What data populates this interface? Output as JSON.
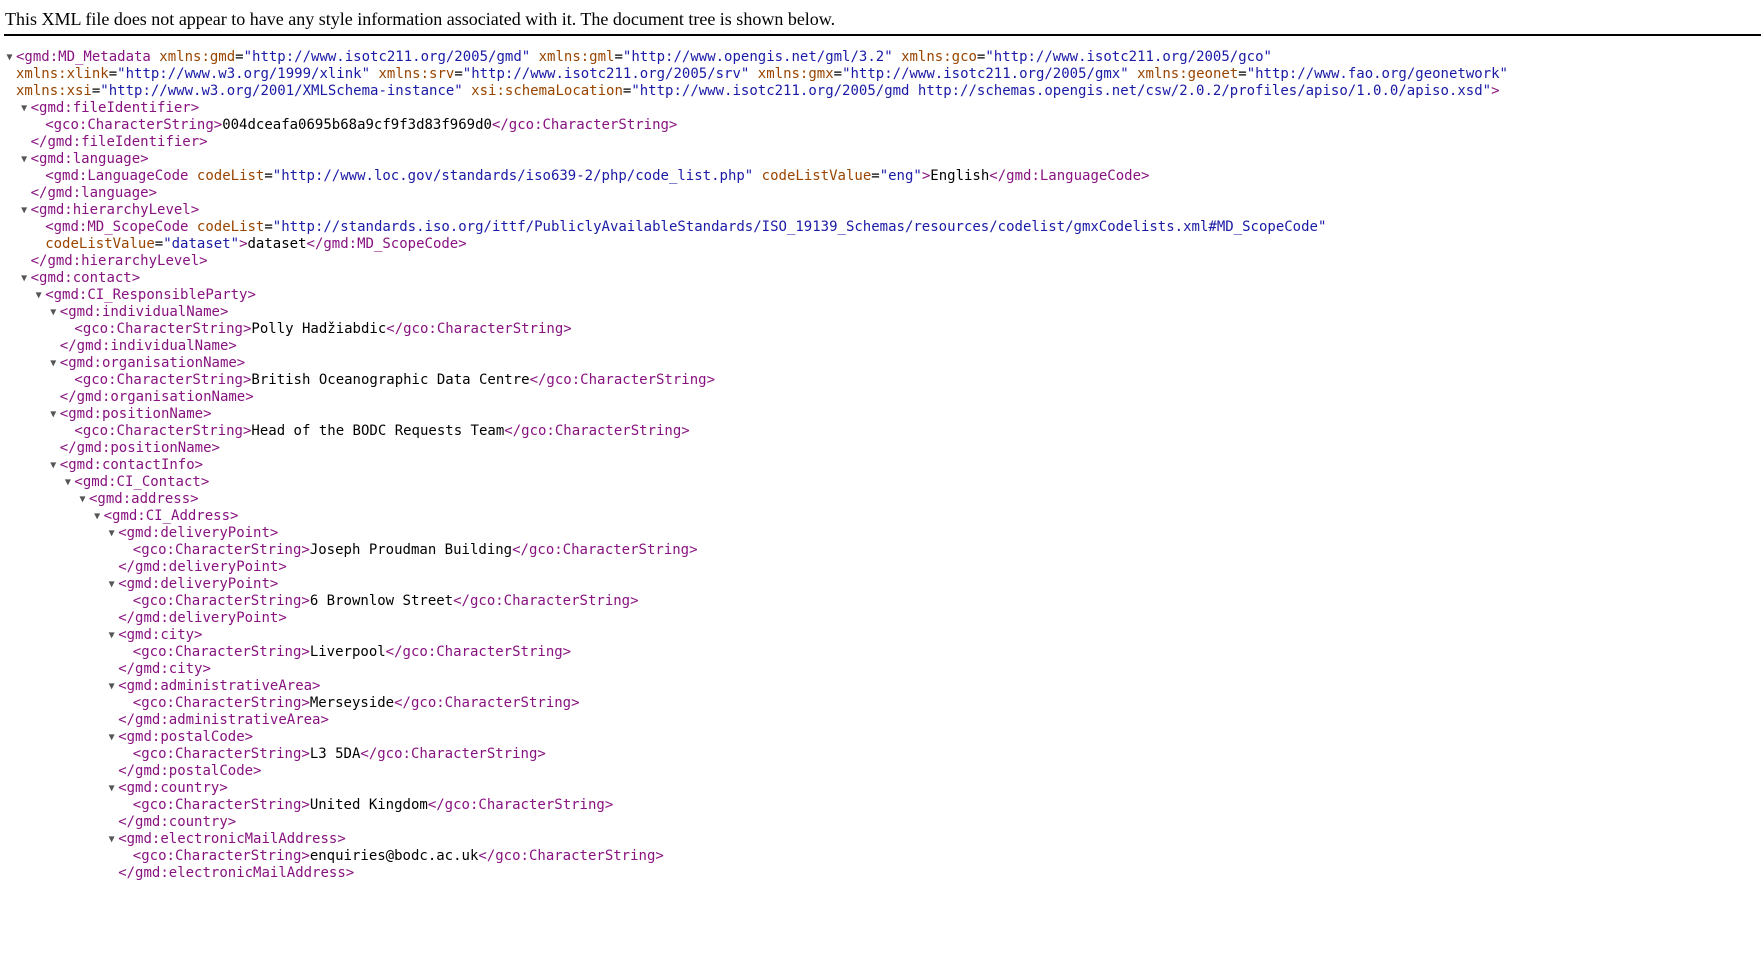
{
  "banner": "This XML file does not appear to have any style information associated with it. The document tree is shown below.",
  "tree": [
    {
      "indent": 0,
      "toggle": true,
      "parts": [
        [
          "t",
          "<gmd:MD_Metadata"
        ],
        [
          "x",
          " "
        ],
        [
          "n",
          "xmlns:gmd"
        ],
        [
          "x",
          "="
        ],
        [
          "v",
          "\"http://www.isotc211.org/2005/gmd\""
        ],
        [
          "x",
          " "
        ],
        [
          "n",
          "xmlns:gml"
        ],
        [
          "x",
          "="
        ],
        [
          "v",
          "\"http://www.opengis.net/gml/3.2\""
        ],
        [
          "x",
          " "
        ],
        [
          "n",
          "xmlns:gco"
        ],
        [
          "x",
          "="
        ],
        [
          "v",
          "\"http://www.isotc211.org/2005/gco\""
        ]
      ]
    },
    {
      "indent": 0,
      "toggle": false,
      "parts": [
        [
          "n",
          "xmlns:xlink"
        ],
        [
          "x",
          "="
        ],
        [
          "v",
          "\"http://www.w3.org/1999/xlink\""
        ],
        [
          "x",
          " "
        ],
        [
          "n",
          "xmlns:srv"
        ],
        [
          "x",
          "="
        ],
        [
          "v",
          "\"http://www.isotc211.org/2005/srv\""
        ],
        [
          "x",
          " "
        ],
        [
          "n",
          "xmlns:gmx"
        ],
        [
          "x",
          "="
        ],
        [
          "v",
          "\"http://www.isotc211.org/2005/gmx\""
        ],
        [
          "x",
          " "
        ],
        [
          "n",
          "xmlns:geonet"
        ],
        [
          "x",
          "="
        ],
        [
          "v",
          "\"http://www.fao.org/geonetwork\""
        ]
      ]
    },
    {
      "indent": 0,
      "toggle": false,
      "parts": [
        [
          "n",
          "xmlns:xsi"
        ],
        [
          "x",
          "="
        ],
        [
          "v",
          "\"http://www.w3.org/2001/XMLSchema-instance\""
        ],
        [
          "x",
          " "
        ],
        [
          "n",
          "xsi:schemaLocation"
        ],
        [
          "x",
          "="
        ],
        [
          "v",
          "\"http://www.isotc211.org/2005/gmd http://schemas.opengis.net/csw/2.0.2/profiles/apiso/1.0.0/apiso.xsd\""
        ],
        [
          "t",
          ">"
        ]
      ]
    },
    {
      "indent": 1,
      "toggle": true,
      "parts": [
        [
          "t",
          "<gmd:fileIdentifier>"
        ]
      ]
    },
    {
      "indent": 2,
      "toggle": false,
      "parts": [
        [
          "t",
          "<gco:CharacterString>"
        ],
        [
          "x",
          "004dceafa0695b68a9cf9f3d83f969d0"
        ],
        [
          "t",
          "</gco:CharacterString>"
        ]
      ]
    },
    {
      "indent": 1,
      "toggle": false,
      "parts": [
        [
          "t",
          "</gmd:fileIdentifier>"
        ]
      ]
    },
    {
      "indent": 1,
      "toggle": true,
      "parts": [
        [
          "t",
          "<gmd:language>"
        ]
      ]
    },
    {
      "indent": 2,
      "toggle": false,
      "parts": [
        [
          "t",
          "<gmd:LanguageCode"
        ],
        [
          "x",
          " "
        ],
        [
          "n",
          "codeList"
        ],
        [
          "x",
          "="
        ],
        [
          "v",
          "\"http://www.loc.gov/standards/iso639-2/php/code_list.php\""
        ],
        [
          "x",
          " "
        ],
        [
          "n",
          "codeListValue"
        ],
        [
          "x",
          "="
        ],
        [
          "v",
          "\"eng\""
        ],
        [
          "t",
          ">"
        ],
        [
          "x",
          "English"
        ],
        [
          "t",
          "</gmd:LanguageCode>"
        ]
      ]
    },
    {
      "indent": 1,
      "toggle": false,
      "parts": [
        [
          "t",
          "</gmd:language>"
        ]
      ]
    },
    {
      "indent": 1,
      "toggle": true,
      "parts": [
        [
          "t",
          "<gmd:hierarchyLevel>"
        ]
      ]
    },
    {
      "indent": 2,
      "toggle": false,
      "parts": [
        [
          "t",
          "<gmd:MD_ScopeCode"
        ],
        [
          "x",
          " "
        ],
        [
          "n",
          "codeList"
        ],
        [
          "x",
          "="
        ],
        [
          "v",
          "\"http://standards.iso.org/ittf/PubliclyAvailableStandards/ISO_19139_Schemas/resources/codelist/gmxCodelists.xml#MD_ScopeCode\""
        ]
      ]
    },
    {
      "indent": 2,
      "toggle": false,
      "parts": [
        [
          "n",
          "codeListValue"
        ],
        [
          "x",
          "="
        ],
        [
          "v",
          "\"dataset\""
        ],
        [
          "t",
          ">"
        ],
        [
          "x",
          "dataset"
        ],
        [
          "t",
          "</gmd:MD_ScopeCode>"
        ]
      ]
    },
    {
      "indent": 1,
      "toggle": false,
      "parts": [
        [
          "t",
          "</gmd:hierarchyLevel>"
        ]
      ]
    },
    {
      "indent": 1,
      "toggle": true,
      "parts": [
        [
          "t",
          "<gmd:contact>"
        ]
      ]
    },
    {
      "indent": 2,
      "toggle": true,
      "parts": [
        [
          "t",
          "<gmd:CI_ResponsibleParty>"
        ]
      ]
    },
    {
      "indent": 3,
      "toggle": true,
      "parts": [
        [
          "t",
          "<gmd:individualName>"
        ]
      ]
    },
    {
      "indent": 4,
      "toggle": false,
      "parts": [
        [
          "t",
          "<gco:CharacterString>"
        ],
        [
          "x",
          "Polly Hadžiabdic"
        ],
        [
          "t",
          "</gco:CharacterString>"
        ]
      ]
    },
    {
      "indent": 3,
      "toggle": false,
      "parts": [
        [
          "t",
          "</gmd:individualName>"
        ]
      ]
    },
    {
      "indent": 3,
      "toggle": true,
      "parts": [
        [
          "t",
          "<gmd:organisationName>"
        ]
      ]
    },
    {
      "indent": 4,
      "toggle": false,
      "parts": [
        [
          "t",
          "<gco:CharacterString>"
        ],
        [
          "x",
          "British Oceanographic Data Centre"
        ],
        [
          "t",
          "</gco:CharacterString>"
        ]
      ]
    },
    {
      "indent": 3,
      "toggle": false,
      "parts": [
        [
          "t",
          "</gmd:organisationName>"
        ]
      ]
    },
    {
      "indent": 3,
      "toggle": true,
      "parts": [
        [
          "t",
          "<gmd:positionName>"
        ]
      ]
    },
    {
      "indent": 4,
      "toggle": false,
      "parts": [
        [
          "t",
          "<gco:CharacterString>"
        ],
        [
          "x",
          "Head of the BODC Requests Team"
        ],
        [
          "t",
          "</gco:CharacterString>"
        ]
      ]
    },
    {
      "indent": 3,
      "toggle": false,
      "parts": [
        [
          "t",
          "</gmd:positionName>"
        ]
      ]
    },
    {
      "indent": 3,
      "toggle": true,
      "parts": [
        [
          "t",
          "<gmd:contactInfo>"
        ]
      ]
    },
    {
      "indent": 4,
      "toggle": true,
      "parts": [
        [
          "t",
          "<gmd:CI_Contact>"
        ]
      ]
    },
    {
      "indent": 5,
      "toggle": true,
      "parts": [
        [
          "t",
          "<gmd:address>"
        ]
      ]
    },
    {
      "indent": 6,
      "toggle": true,
      "parts": [
        [
          "t",
          "<gmd:CI_Address>"
        ]
      ]
    },
    {
      "indent": 7,
      "toggle": true,
      "parts": [
        [
          "t",
          "<gmd:deliveryPoint>"
        ]
      ]
    },
    {
      "indent": 8,
      "toggle": false,
      "parts": [
        [
          "t",
          "<gco:CharacterString>"
        ],
        [
          "x",
          "Joseph Proudman Building"
        ],
        [
          "t",
          "</gco:CharacterString>"
        ]
      ]
    },
    {
      "indent": 7,
      "toggle": false,
      "parts": [
        [
          "t",
          "</gmd:deliveryPoint>"
        ]
      ]
    },
    {
      "indent": 7,
      "toggle": true,
      "parts": [
        [
          "t",
          "<gmd:deliveryPoint>"
        ]
      ]
    },
    {
      "indent": 8,
      "toggle": false,
      "parts": [
        [
          "t",
          "<gco:CharacterString>"
        ],
        [
          "x",
          "6 Brownlow Street"
        ],
        [
          "t",
          "</gco:CharacterString>"
        ]
      ]
    },
    {
      "indent": 7,
      "toggle": false,
      "parts": [
        [
          "t",
          "</gmd:deliveryPoint>"
        ]
      ]
    },
    {
      "indent": 7,
      "toggle": true,
      "parts": [
        [
          "t",
          "<gmd:city>"
        ]
      ]
    },
    {
      "indent": 8,
      "toggle": false,
      "parts": [
        [
          "t",
          "<gco:CharacterString>"
        ],
        [
          "x",
          "Liverpool"
        ],
        [
          "t",
          "</gco:CharacterString>"
        ]
      ]
    },
    {
      "indent": 7,
      "toggle": false,
      "parts": [
        [
          "t",
          "</gmd:city>"
        ]
      ]
    },
    {
      "indent": 7,
      "toggle": true,
      "parts": [
        [
          "t",
          "<gmd:administrativeArea>"
        ]
      ]
    },
    {
      "indent": 8,
      "toggle": false,
      "parts": [
        [
          "t",
          "<gco:CharacterString>"
        ],
        [
          "x",
          "Merseyside"
        ],
        [
          "t",
          "</gco:CharacterString>"
        ]
      ]
    },
    {
      "indent": 7,
      "toggle": false,
      "parts": [
        [
          "t",
          "</gmd:administrativeArea>"
        ]
      ]
    },
    {
      "indent": 7,
      "toggle": true,
      "parts": [
        [
          "t",
          "<gmd:postalCode>"
        ]
      ]
    },
    {
      "indent": 8,
      "toggle": false,
      "parts": [
        [
          "t",
          "<gco:CharacterString>"
        ],
        [
          "x",
          "L3 5DA"
        ],
        [
          "t",
          "</gco:CharacterString>"
        ]
      ]
    },
    {
      "indent": 7,
      "toggle": false,
      "parts": [
        [
          "t",
          "</gmd:postalCode>"
        ]
      ]
    },
    {
      "indent": 7,
      "toggle": true,
      "parts": [
        [
          "t",
          "<gmd:country>"
        ]
      ]
    },
    {
      "indent": 8,
      "toggle": false,
      "parts": [
        [
          "t",
          "<gco:CharacterString>"
        ],
        [
          "x",
          "United Kingdom"
        ],
        [
          "t",
          "</gco:CharacterString>"
        ]
      ]
    },
    {
      "indent": 7,
      "toggle": false,
      "parts": [
        [
          "t",
          "</gmd:country>"
        ]
      ]
    },
    {
      "indent": 7,
      "toggle": true,
      "parts": [
        [
          "t",
          "<gmd:electronicMailAddress>"
        ]
      ]
    },
    {
      "indent": 8,
      "toggle": false,
      "parts": [
        [
          "t",
          "<gco:CharacterString>"
        ],
        [
          "x",
          "enquiries@bodc.ac.uk"
        ],
        [
          "t",
          "</gco:CharacterString>"
        ]
      ]
    },
    {
      "indent": 7,
      "toggle": false,
      "parts": [
        [
          "t",
          "</gmd:electronicMailAddress>"
        ]
      ]
    }
  ]
}
